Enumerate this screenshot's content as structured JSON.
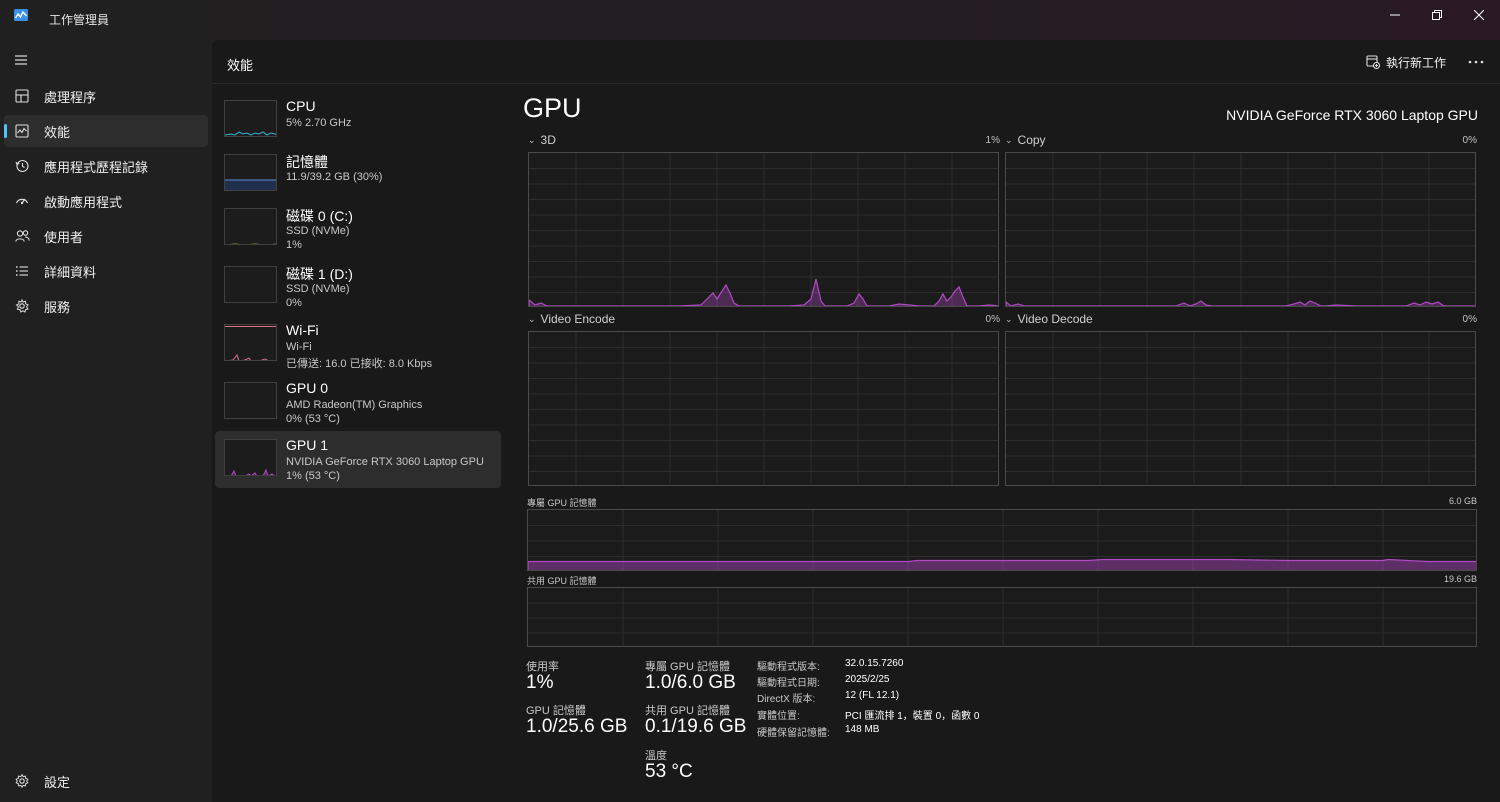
{
  "window": {
    "title": "工作管理員",
    "icon": "task-manager-icon",
    "controls": [
      "minimize-icon",
      "maximize-icon",
      "close-icon"
    ]
  },
  "nav": {
    "items": [
      {
        "label": "處理程序",
        "icon": "processes-icon"
      },
      {
        "label": "效能",
        "icon": "performance-icon",
        "active": true
      },
      {
        "label": "應用程式歷程記錄",
        "icon": "history-icon"
      },
      {
        "label": "啟動應用程式",
        "icon": "startup-icon"
      },
      {
        "label": "使用者",
        "icon": "users-icon"
      },
      {
        "label": "詳細資料",
        "icon": "details-icon"
      },
      {
        "label": "服務",
        "icon": "services-icon"
      }
    ],
    "settings_label": "設定"
  },
  "header": {
    "title": "效能",
    "run_task_label": "執行新工作"
  },
  "devices": [
    {
      "name": "CPU",
      "sub1": "5%  2.70 GHz",
      "sub2": "",
      "color": "#2eb6d9"
    },
    {
      "name": "記憶體",
      "sub1": "11.9/39.2 GB (30%)",
      "sub2": "",
      "color": "#5b8fd9"
    },
    {
      "name": "磁碟 0 (C:)",
      "sub1": "SSD (NVMe)",
      "sub2": "1%",
      "color": "#8ab04a"
    },
    {
      "name": "磁碟 1 (D:)",
      "sub1": "SSD (NVMe)",
      "sub2": "0%",
      "color": "#8ab04a"
    },
    {
      "name": "Wi-Fi",
      "sub1": "Wi-Fi",
      "sub2": "已傳送: 16.0  已接收: 8.0 Kbps",
      "color": "#d9718b"
    },
    {
      "name": "GPU 0",
      "sub1": "AMD Radeon(TM) Graphics",
      "sub2": "0% (53 °C)",
      "color": "#b04ac4"
    },
    {
      "name": "GPU 1",
      "sub1": "NVIDIA GeForce RTX 3060 Laptop GPU",
      "sub2": "1% (53 °C)",
      "color": "#b04ac4",
      "selected": true
    }
  ],
  "gpu": {
    "title": "GPU",
    "model": "NVIDIA GeForce RTX 3060 Laptop GPU",
    "accent": "#b04ac4",
    "engines": [
      {
        "label": "3D",
        "pct": "1%"
      },
      {
        "label": "Copy",
        "pct": "0%"
      },
      {
        "label": "Video Encode",
        "pct": "0%"
      },
      {
        "label": "Video Decode",
        "pct": "0%"
      }
    ],
    "dedicated_label": "專屬 GPU 記憶體",
    "dedicated_max": "6.0 GB",
    "shared_label": "共用 GPU 記憶體",
    "shared_max": "19.6 GB",
    "dedicated_fill_fraction": 0.17
  },
  "stats": {
    "usage_label": "使用率",
    "usage_value": "1%",
    "gpu_mem_label": "GPU 記憶體",
    "gpu_mem_value": "1.0/25.6 GB",
    "dedicated_label": "專屬 GPU 記憶體",
    "dedicated_value": "1.0/6.0 GB",
    "shared_label": "共用 GPU 記憶體",
    "shared_value": "0.1/19.6 GB",
    "temp_label": "溫度",
    "temp_value": "53 °C"
  },
  "info": [
    {
      "key": "驅動程式版本:",
      "value": "32.0.15.7260"
    },
    {
      "key": "驅動程式日期:",
      "value": "2025/2/25"
    },
    {
      "key": "DirectX 版本:",
      "value": "12 (FL 12.1)"
    },
    {
      "key": "實體位置:",
      "value": "PCI 匯流排 1，裝置 0，函數 0"
    },
    {
      "key": "硬體保留記憶體:",
      "value": "148 MB"
    }
  ]
}
